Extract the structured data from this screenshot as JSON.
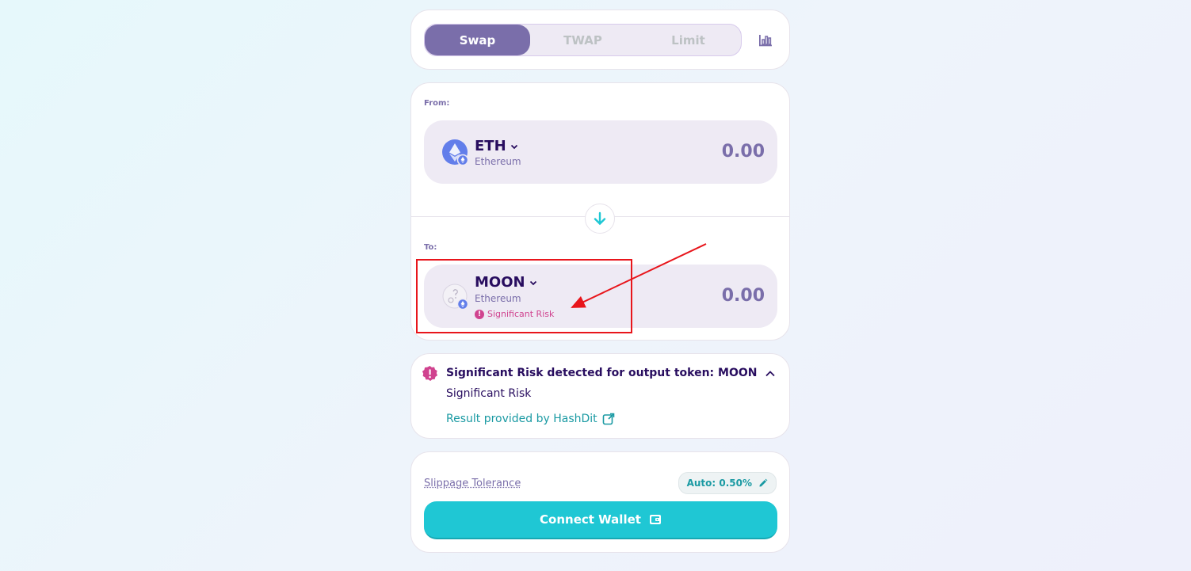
{
  "tabs": {
    "items": [
      {
        "label": "Swap",
        "active": true
      },
      {
        "label": "TWAP",
        "active": false
      },
      {
        "label": "Limit",
        "active": false
      }
    ],
    "chart_icon": "bar-chart-icon"
  },
  "from": {
    "label": "From:",
    "symbol": "ETH",
    "network": "Ethereum",
    "amount": "0.00",
    "icon": "ethereum-icon"
  },
  "to": {
    "label": "To:",
    "symbol": "MOON",
    "network": "Ethereum",
    "amount": "0.00",
    "risk_tag": "Significant Risk",
    "icon": "unknown-token-icon"
  },
  "risk": {
    "title": "Significant Risk detected for output token: MOON",
    "level": "Significant Risk",
    "provider_link": "Result provided by HashDit"
  },
  "settings": {
    "slippage_label": "Slippage Tolerance",
    "slippage_value": "Auto: 0.50%"
  },
  "connect": {
    "label": "Connect Wallet"
  },
  "colors": {
    "accent": "#1fc7d4",
    "primary_text": "#280d5f",
    "secondary": "#7a6eaa",
    "risk": "#d0438f",
    "annotation": "#e8151b"
  }
}
